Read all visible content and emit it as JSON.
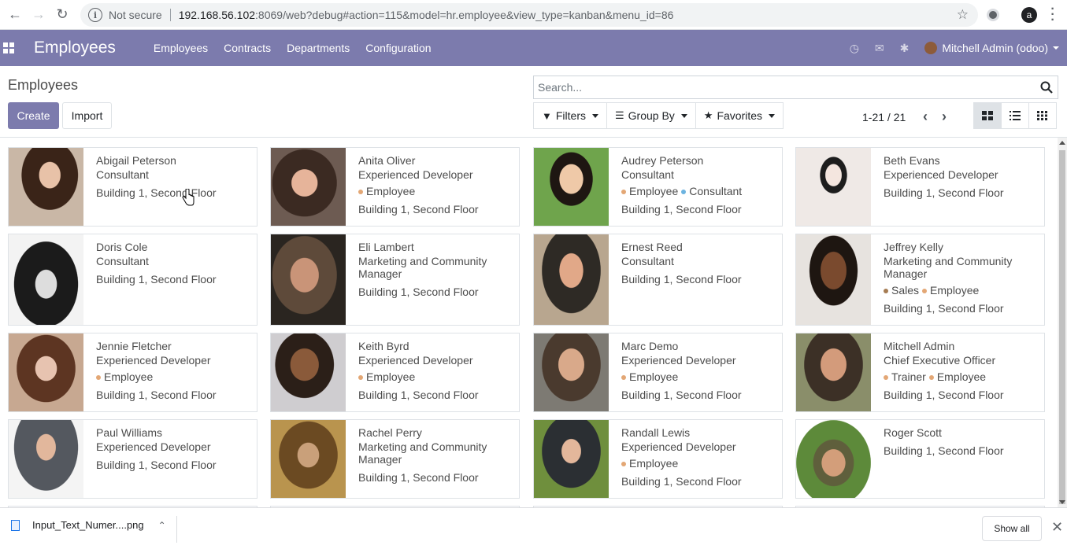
{
  "browser": {
    "security_label": "Not secure",
    "url_host": "192.168.56.102",
    "url_path": ":8069/web?debug#action=115&model=hr.employee&view_type=kanban&menu_id=86",
    "profile_initial": "a"
  },
  "navbar": {
    "app_name": "Employees",
    "menu": [
      "Employees",
      "Contracts",
      "Departments",
      "Configuration"
    ],
    "user_name": "Mitchell Admin (odoo)"
  },
  "control_panel": {
    "breadcrumb": "Employees",
    "create_label": "Create",
    "import_label": "Import",
    "search_placeholder": "Search...",
    "filters_label": "Filters",
    "groupby_label": "Group By",
    "favorites_label": "Favorites",
    "pager": "1-21 / 21"
  },
  "colors": {
    "brand": "#7c7bad",
    "tag_employee": "#e3a775",
    "tag_consultant": "#6cb3e0",
    "tag_sales": "#a67c52",
    "tag_trainer": "#e3a775"
  },
  "employees": [
    {
      "name": "Abigail Peterson",
      "job": "Consultant",
      "tags": [],
      "location": "Building 1, Second Floor"
    },
    {
      "name": "Anita Oliver",
      "job": "Experienced Developer",
      "tags": [
        {
          "label": "Employee",
          "color": "#e3a775"
        }
      ],
      "location": "Building 1, Second Floor"
    },
    {
      "name": "Audrey Peterson",
      "job": "Consultant",
      "tags": [
        {
          "label": "Employee",
          "color": "#e3a775"
        },
        {
          "label": "Consultant",
          "color": "#6cb3e0"
        }
      ],
      "location": "Building 1, Second Floor"
    },
    {
      "name": "Beth Evans",
      "job": "Experienced Developer",
      "tags": [],
      "location": "Building 1, Second Floor"
    },
    {
      "name": "Doris Cole",
      "job": "Consultant",
      "tags": [],
      "location": "Building 1, Second Floor"
    },
    {
      "name": "Eli Lambert",
      "job": "Marketing and Community Manager",
      "tags": [],
      "location": "Building 1, Second Floor"
    },
    {
      "name": "Ernest Reed",
      "job": "Consultant",
      "tags": [],
      "location": "Building 1, Second Floor"
    },
    {
      "name": "Jeffrey Kelly",
      "job": "Marketing and Community Manager",
      "tags": [
        {
          "label": "Sales",
          "color": "#a67c52"
        },
        {
          "label": "Employee",
          "color": "#e3a775"
        }
      ],
      "location": "Building 1, Second Floor"
    },
    {
      "name": "Jennie Fletcher",
      "job": "Experienced Developer",
      "tags": [
        {
          "label": "Employee",
          "color": "#e3a775"
        }
      ],
      "location": "Building 1, Second Floor"
    },
    {
      "name": "Keith Byrd",
      "job": "Experienced Developer",
      "tags": [
        {
          "label": "Employee",
          "color": "#e3a775"
        }
      ],
      "location": "Building 1, Second Floor"
    },
    {
      "name": "Marc Demo",
      "job": "Experienced Developer",
      "tags": [
        {
          "label": "Employee",
          "color": "#e3a775"
        }
      ],
      "location": "Building 1, Second Floor"
    },
    {
      "name": "Mitchell Admin",
      "job": "Chief Executive Officer",
      "tags": [
        {
          "label": "Trainer",
          "color": "#e3a775"
        },
        {
          "label": "Employee",
          "color": "#e3a775"
        }
      ],
      "location": "Building 1, Second Floor"
    },
    {
      "name": "Paul Williams",
      "job": "Experienced Developer",
      "tags": [],
      "location": "Building 1, Second Floor"
    },
    {
      "name": "Rachel Perry",
      "job": "Marketing and Community Manager",
      "tags": [],
      "location": "Building 1, Second Floor"
    },
    {
      "name": "Randall Lewis",
      "job": "Experienced Developer",
      "tags": [
        {
          "label": "Employee",
          "color": "#e3a775"
        }
      ],
      "location": "Building 1, Second Floor"
    },
    {
      "name": "Roger Scott",
      "job": "",
      "tags": [],
      "location": "Building 1, Second Floor"
    }
  ],
  "downloads": {
    "file_name": "Input_Text_Numer....png",
    "show_all_label": "Show all"
  }
}
